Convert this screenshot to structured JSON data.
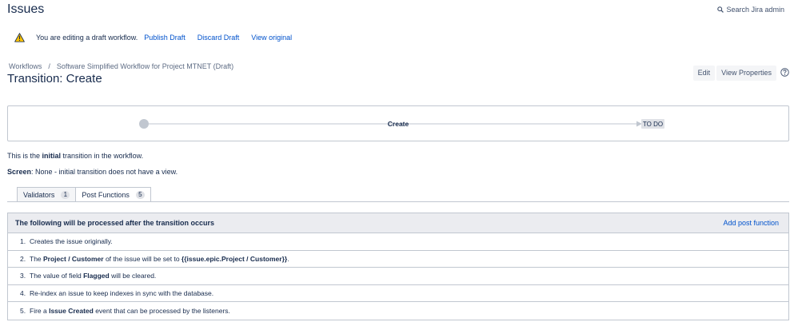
{
  "header": {
    "title": "Issues",
    "search_label": "Search Jira admin"
  },
  "draft": {
    "message": "You are editing a draft workflow.",
    "publish": "Publish Draft",
    "discard": "Discard Draft",
    "view_original": "View original"
  },
  "breadcrumb": {
    "workflows": "Workflows",
    "separator": "/",
    "workflow_name": "Software Simplified Workflow for Project MTNET (Draft)"
  },
  "transition": {
    "title": "Transition: Create",
    "edit": "Edit",
    "view_properties": "View Properties"
  },
  "diagram": {
    "transition_label": "Create",
    "target_status": "TO DO"
  },
  "info": {
    "line1_pre": "This is the ",
    "line1_bold": "initial",
    "line1_post": " transition in the workflow.",
    "screen_label": "Screen",
    "screen_value": ": None - initial transition does not have a view."
  },
  "tabs": [
    {
      "label": "Validators",
      "count": "1"
    },
    {
      "label": "Post Functions",
      "count": "5"
    }
  ],
  "post_functions": {
    "header": "The following will be processed after the transition occurs",
    "add": "Add post function",
    "items": [
      {
        "num": "1.",
        "pre": "Creates the issue originally.",
        "b1": "",
        "mid": "",
        "b2": "",
        "post": ""
      },
      {
        "num": "2.",
        "pre": "The ",
        "b1": "Project / Customer",
        "mid": " of the issue will be set to ",
        "b2": "{{issue.epic.Project / Customer}}",
        "post": "."
      },
      {
        "num": "3.",
        "pre": "The value of field ",
        "b1": "Flagged",
        "mid": " will be cleared.",
        "b2": "",
        "post": ""
      },
      {
        "num": "4.",
        "pre": "Re-index an issue to keep indexes in sync with the database.",
        "b1": "",
        "mid": "",
        "b2": "",
        "post": ""
      },
      {
        "num": "5.",
        "pre": "Fire a ",
        "b1": "Issue Created",
        "mid": " event that can be processed by the listeners.",
        "b2": "",
        "post": ""
      }
    ]
  }
}
